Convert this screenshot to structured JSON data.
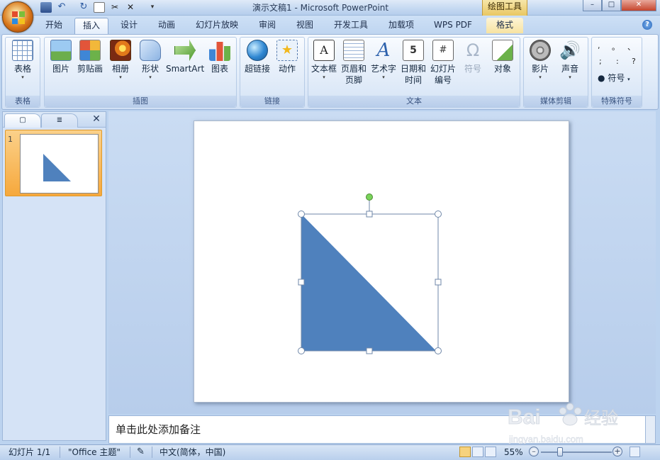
{
  "window": {
    "title": "演示文稿1 - Microsoft PowerPoint",
    "context_tools_label": "绘图工具",
    "min_label": "–",
    "max_label": "□",
    "close_label": "✕"
  },
  "tabs": [
    {
      "label": "开始"
    },
    {
      "label": "插入",
      "active": true
    },
    {
      "label": "设计"
    },
    {
      "label": "动画"
    },
    {
      "label": "幻灯片放映"
    },
    {
      "label": "审阅"
    },
    {
      "label": "视图"
    },
    {
      "label": "开发工具"
    },
    {
      "label": "加载项"
    },
    {
      "label": "WPS PDF"
    },
    {
      "label": "格式"
    }
  ],
  "help_label": "?",
  "ribbon": {
    "groups": [
      {
        "label": "表格"
      },
      {
        "label": "插图"
      },
      {
        "label": "链接"
      },
      {
        "label": "文本"
      },
      {
        "label": "媒体剪辑"
      },
      {
        "label": "特殊符号"
      }
    ],
    "buttons": {
      "table": "表格",
      "picture": "图片",
      "clipart": "剪贴画",
      "album": "相册",
      "shapes": "形状",
      "smartart": "SmartArt",
      "chart": "图表",
      "hyperlink": "超链接",
      "action": "动作",
      "textbox": "文本框",
      "header_footer_1": "页眉和",
      "header_footer_2": "页脚",
      "wordart": "艺术字",
      "datetime_1": "日期和",
      "datetime_2": "时间",
      "slide_number_1": "幻灯片",
      "slide_number_2": "编号",
      "symbol": "符号",
      "object": "对象",
      "movie": "影片",
      "sound": "声音",
      "special_symbol": "符号"
    },
    "punctuation": [
      ",",
      "。",
      "、",
      ";",
      ":",
      "?"
    ]
  },
  "slides_pane": {
    "close_label": "✕",
    "thumb_number": "1"
  },
  "notes": {
    "placeholder": "单击此处添加备注"
  },
  "status": {
    "slide_counter": "幻灯片 1/1",
    "theme": "\"Office 主题\"",
    "language": "中文(简体，中国)",
    "zoom": "55%",
    "zoom_percent": 55
  },
  "colors": {
    "shape_fill": "#4f81bd",
    "selection_handle": "#ffffff",
    "rotate_handle": "#79d35a"
  }
}
